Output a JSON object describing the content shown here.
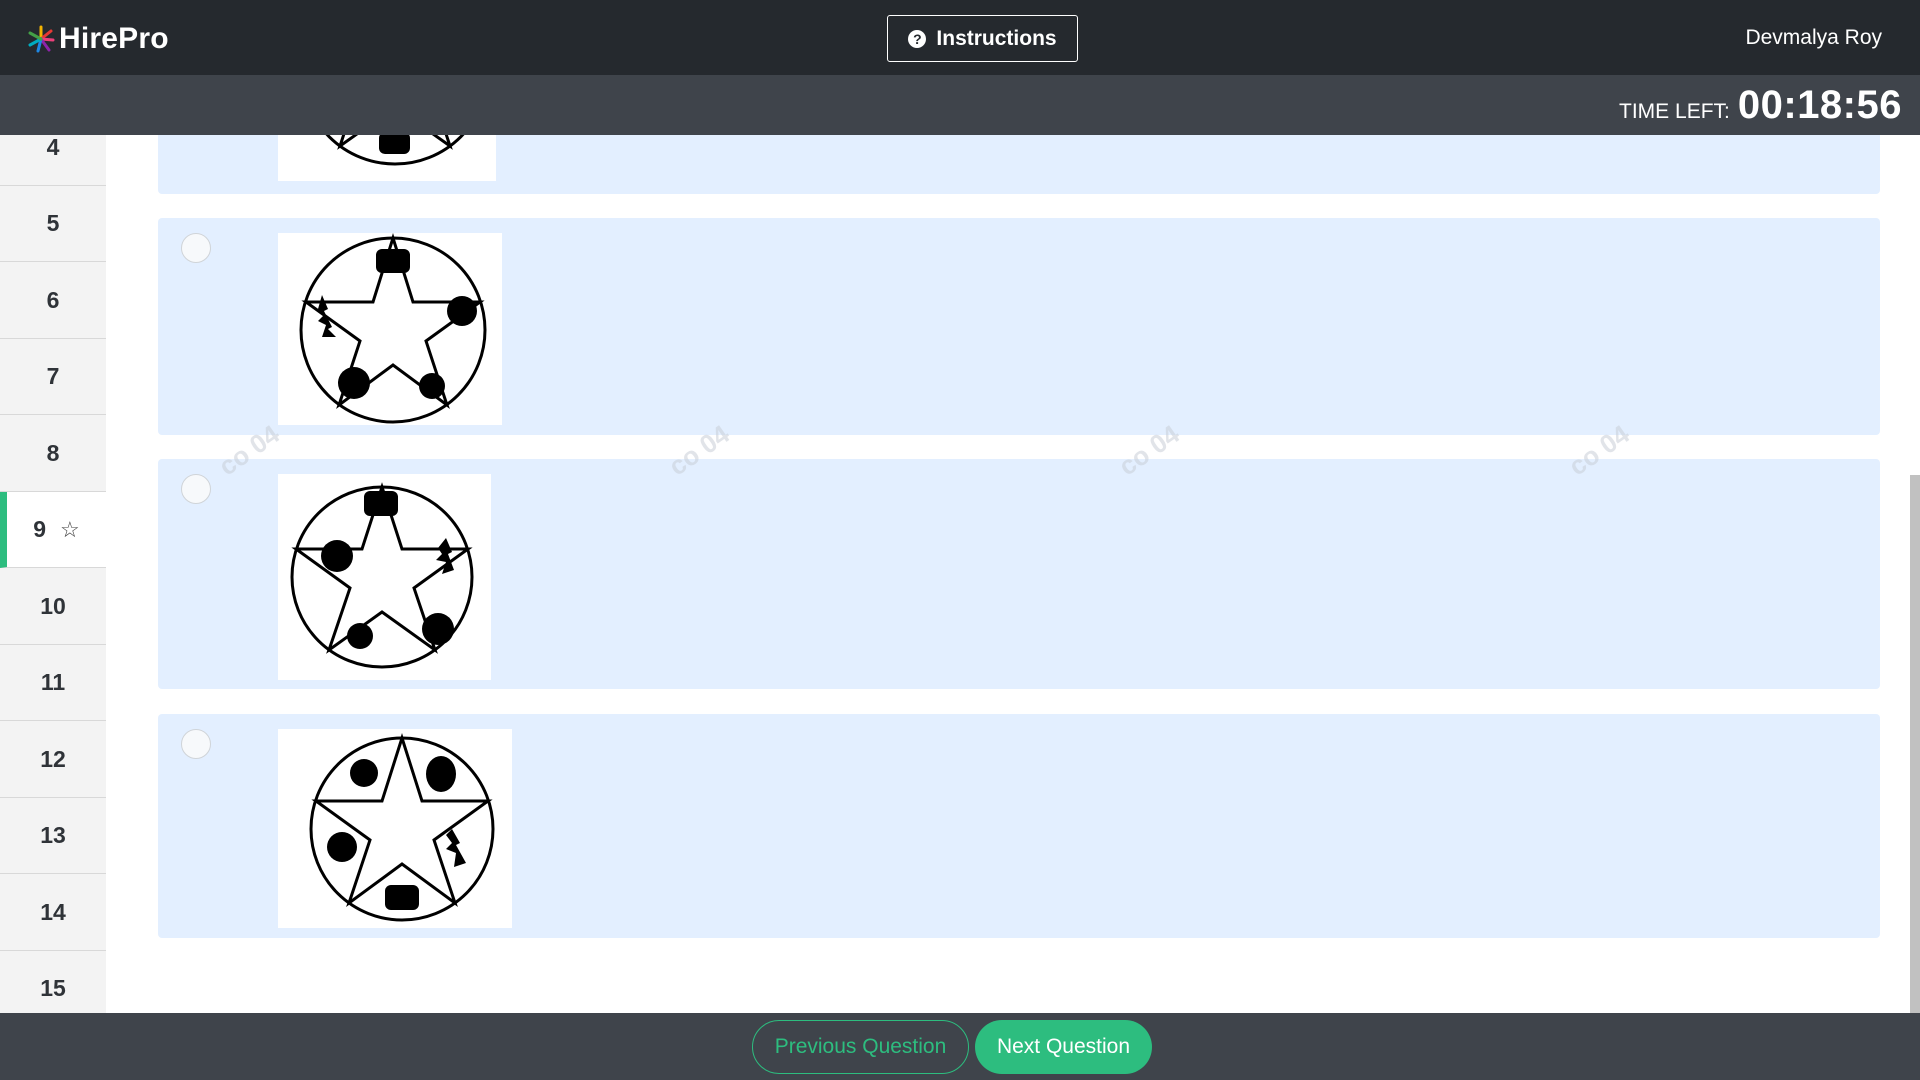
{
  "header": {
    "brand": "HirePro",
    "instructions_label": "Instructions",
    "user_name": "Devmalya Roy"
  },
  "timer": {
    "label": "TIME LEFT:",
    "value": "00:18:56"
  },
  "sidebar": {
    "items": [
      {
        "label": "4"
      },
      {
        "label": "5"
      },
      {
        "label": "6"
      },
      {
        "label": "7"
      },
      {
        "label": "8"
      },
      {
        "label": "9",
        "active": true,
        "starred": false
      },
      {
        "label": "10"
      },
      {
        "label": "11"
      },
      {
        "label": "12"
      },
      {
        "label": "13"
      },
      {
        "label": "14"
      },
      {
        "label": "15"
      }
    ]
  },
  "options": [
    {
      "selected": false
    },
    {
      "selected": false
    },
    {
      "selected": false
    },
    {
      "selected": false
    }
  ],
  "footer": {
    "prev_label": "Previous Question",
    "next_label": "Next Question"
  },
  "colors": {
    "accent": "#2dbd7f",
    "topbar": "#25292e",
    "subbar": "#3f444b",
    "option_bg": "#e3efff"
  },
  "icons": {
    "logo": "hirepro-logo-icon",
    "help": "question-circle-icon",
    "flag": "star-outline-icon"
  }
}
